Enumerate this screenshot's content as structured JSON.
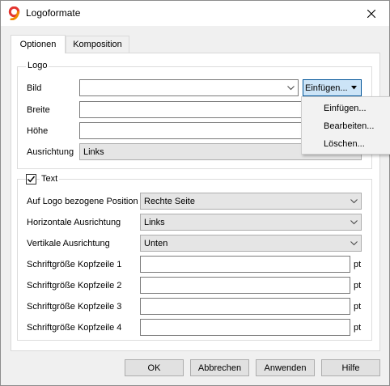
{
  "window": {
    "title": "Logoformate",
    "app_icon": "9-logo-icon",
    "close_icon": "close-icon"
  },
  "tabs": [
    {
      "label": "Optionen",
      "active": true
    },
    {
      "label": "Komposition",
      "active": false
    }
  ],
  "logo_group": {
    "title": "Logo",
    "bild_label": "Bild",
    "bild_value": "",
    "insert_button": "Einfügen...",
    "breite_label": "Breite",
    "breite_value": "",
    "hoehe_label": "Höhe",
    "hoehe_value": "",
    "ausrichtung_label": "Ausrichtung",
    "ausrichtung_value": "Links"
  },
  "insert_menu": {
    "items": [
      "Einfügen...",
      "Bearbeiten...",
      "Löschen..."
    ]
  },
  "text_group": {
    "title": "Text",
    "checked": true,
    "position_label": "Auf Logo bezogene Position",
    "position_value": "Rechte Seite",
    "horizontal_label": "Horizontale Ausrichtung",
    "horizontal_value": "Links",
    "vertical_label": "Vertikale Ausrichtung",
    "vertical_value": "Unten",
    "font_rows": [
      {
        "label": "Schriftgröße Kopfzeile 1",
        "value": "",
        "unit": "pt"
      },
      {
        "label": "Schriftgröße Kopfzeile 2",
        "value": "",
        "unit": "pt"
      },
      {
        "label": "Schriftgröße Kopfzeile 3",
        "value": "",
        "unit": "pt"
      },
      {
        "label": "Schriftgröße Kopfzeile 4",
        "value": "",
        "unit": "pt"
      }
    ]
  },
  "buttons": {
    "ok": "OK",
    "cancel": "Abbrechen",
    "apply": "Anwenden",
    "help": "Hilfe"
  },
  "colors": {
    "accent_border": "#005499",
    "accent_fill": "#cce4f7",
    "logo_red": "#e3342f",
    "logo_orange": "#f08a00"
  }
}
